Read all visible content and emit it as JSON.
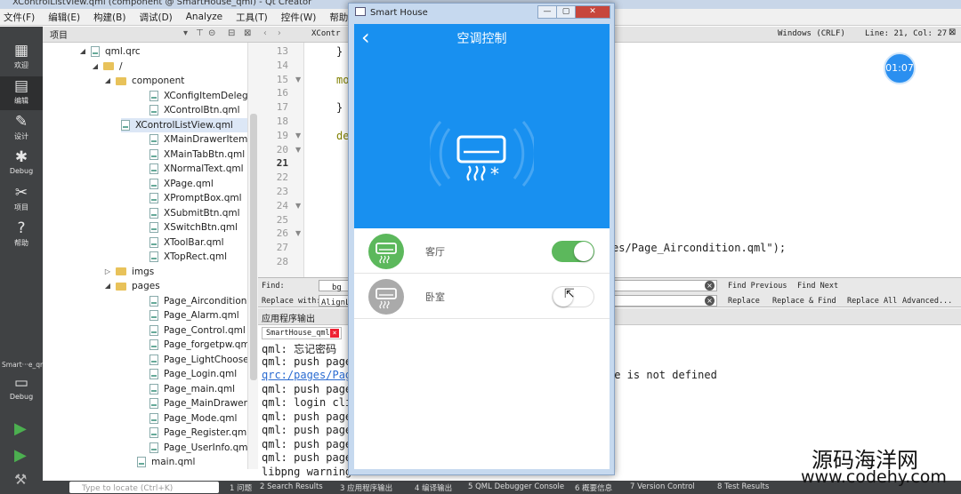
{
  "window_title": "XControlListView.qml (component @ SmartHouse_qml) - Qt Creator",
  "menu": [
    "文件(F)",
    "编辑(E)",
    "构建(B)",
    "调试(D)",
    "Analyze",
    "工具(T)",
    "控件(W)",
    "帮助(H)"
  ],
  "modes": [
    {
      "icon": "grid-icon",
      "glyph": "▦",
      "label": "欢迎"
    },
    {
      "icon": "edit-icon",
      "glyph": "▤",
      "label": "编辑"
    },
    {
      "icon": "pen-icon",
      "glyph": "✎",
      "label": "设计"
    },
    {
      "icon": "bug-icon",
      "glyph": "✱",
      "label": "Debug"
    },
    {
      "icon": "wrench-icon",
      "glyph": "✂",
      "label": "项目"
    },
    {
      "icon": "help-icon",
      "glyph": "?",
      "label": "帮助"
    }
  ],
  "kit": {
    "project": "Smart···e_qml",
    "mode": "Debug"
  },
  "project_panel": {
    "title": "项目"
  },
  "tree": [
    {
      "label": "qml.qrc",
      "kind": "qrc",
      "depth": 0,
      "expanded": true
    },
    {
      "label": "/",
      "kind": "folder",
      "depth": 1,
      "expanded": true
    },
    {
      "label": "component",
      "kind": "folder",
      "depth": 2,
      "expanded": true
    },
    {
      "label": "XConfigItemDelegate.qml",
      "kind": "file",
      "depth": 3
    },
    {
      "label": "XControlBtn.qml",
      "kind": "file",
      "depth": 3
    },
    {
      "label": "XControlListView.qml",
      "kind": "file",
      "depth": 3,
      "selected": true
    },
    {
      "label": "XMainDrawerItem.qml",
      "kind": "file",
      "depth": 3
    },
    {
      "label": "XMainTabBtn.qml",
      "kind": "file",
      "depth": 3
    },
    {
      "label": "XNormalText.qml",
      "kind": "file",
      "depth": 3
    },
    {
      "label": "XPage.qml",
      "kind": "file",
      "depth": 3
    },
    {
      "label": "XPromptBox.qml",
      "kind": "file",
      "depth": 3
    },
    {
      "label": "XSubmitBtn.qml",
      "kind": "file",
      "depth": 3
    },
    {
      "label": "XSwitchBtn.qml",
      "kind": "file",
      "depth": 3
    },
    {
      "label": "XToolBar.qml",
      "kind": "file",
      "depth": 3
    },
    {
      "label": "XTopRect.qml",
      "kind": "file",
      "depth": 3
    },
    {
      "label": "imgs",
      "kind": "folder",
      "depth": 2,
      "expanded": false
    },
    {
      "label": "pages",
      "kind": "folder",
      "depth": 2,
      "expanded": true
    },
    {
      "label": "Page_AirconditionChoose.qml",
      "kind": "file",
      "depth": 3
    },
    {
      "label": "Page_Alarm.qml",
      "kind": "file",
      "depth": 3
    },
    {
      "label": "Page_Control.qml",
      "kind": "file",
      "depth": 3
    },
    {
      "label": "Page_forgetpw.qml",
      "kind": "file",
      "depth": 3
    },
    {
      "label": "Page_LightChoose.qml",
      "kind": "file",
      "depth": 3
    },
    {
      "label": "Page_Login.qml",
      "kind": "file",
      "depth": 3
    },
    {
      "label": "Page_main.qml",
      "kind": "file",
      "depth": 3
    },
    {
      "label": "Page_MainDrawer.qml",
      "kind": "file",
      "depth": 3
    },
    {
      "label": "Page_Mode.qml",
      "kind": "file",
      "depth": 3
    },
    {
      "label": "Page_Register.qml",
      "kind": "file",
      "depth": 3
    },
    {
      "label": "Page_UserInfo.qml",
      "kind": "file",
      "depth": 3
    },
    {
      "label": "main.qml",
      "kind": "file",
      "depth": 2
    }
  ],
  "editor": {
    "tab": "XContr",
    "encoding": "Windows (CRLF)",
    "position": "Line: 21, Col: 27",
    "current_line": "21",
    "lines": [
      {
        "n": "13",
        "code": "}"
      },
      {
        "n": "14",
        "code": ""
      },
      {
        "n": "15",
        "code": "mo",
        "fold": true
      },
      {
        "n": "16",
        "code": ""
      },
      {
        "n": "17",
        "code": "}"
      },
      {
        "n": "18",
        "code": ""
      },
      {
        "n": "19",
        "code": "de",
        "fold": true
      },
      {
        "n": "20",
        "code": "",
        "fold": true
      },
      {
        "n": "21",
        "code": ""
      },
      {
        "n": "22",
        "code": ""
      },
      {
        "n": "23",
        "code": ""
      },
      {
        "n": "24",
        "code": "",
        "fold": true
      },
      {
        "n": "25",
        "code": ""
      },
      {
        "n": "26",
        "code": "",
        "fold": true
      },
      {
        "n": "27",
        "code": "es/Page_Aircondition.qml\");"
      },
      {
        "n": "28",
        "code": ""
      }
    ]
  },
  "find": {
    "find_label": "Find:",
    "find_value": "bg",
    "replace_label": "Replace with:",
    "replace_value": "AlignL",
    "find_previous": "Find Previous",
    "find_next": "Find Next",
    "replace": "Replace",
    "replace_find": "Replace & Find",
    "replace_all": "Replace All",
    "advanced": "Advanced..."
  },
  "output_panel": {
    "title": "应用程序输出",
    "tab": "SmartHouse_qml",
    "lines": [
      {
        "text": "qml: 忘记密码",
        "link": false
      },
      {
        "text": "qml: push page",
        "link": false,
        "tail": ""
      },
      {
        "text": "qrc:/pages/Pag",
        "link": true,
        "tail": "ge is not defined"
      },
      {
        "text": "qml: push page",
        "link": false
      },
      {
        "text": "qml: login cli",
        "link": false
      },
      {
        "text": "qml: push page",
        "link": false
      },
      {
        "text": "qml: push page",
        "link": false
      },
      {
        "text": "qml: push page",
        "link": false
      },
      {
        "text": "qml: push page",
        "link": false
      },
      {
        "text": "libpng warning",
        "link": false
      }
    ]
  },
  "statusbar": {
    "locator_placeholder": "Type to locate (Ctrl+K)",
    "tabs": [
      "1 问题",
      "2 Search Results",
      "3 应用程序输出",
      "4 编译输出",
      "5 QML Debugger Console",
      "6 概要信息",
      "7 Version Control",
      "8 Test Results"
    ]
  },
  "app": {
    "window_title": "Smart House",
    "heading": "空调控制",
    "header_color": "#1890f0",
    "rooms": [
      {
        "name": "客厅",
        "on": true
      },
      {
        "name": "卧室",
        "on": false
      }
    ],
    "on_color": "#5cb85c",
    "off_color": "#aaaaaa"
  },
  "overlay_timer": "01:07",
  "watermark": {
    "cn": "源码海洋网",
    "url": "www.codehy.com"
  }
}
